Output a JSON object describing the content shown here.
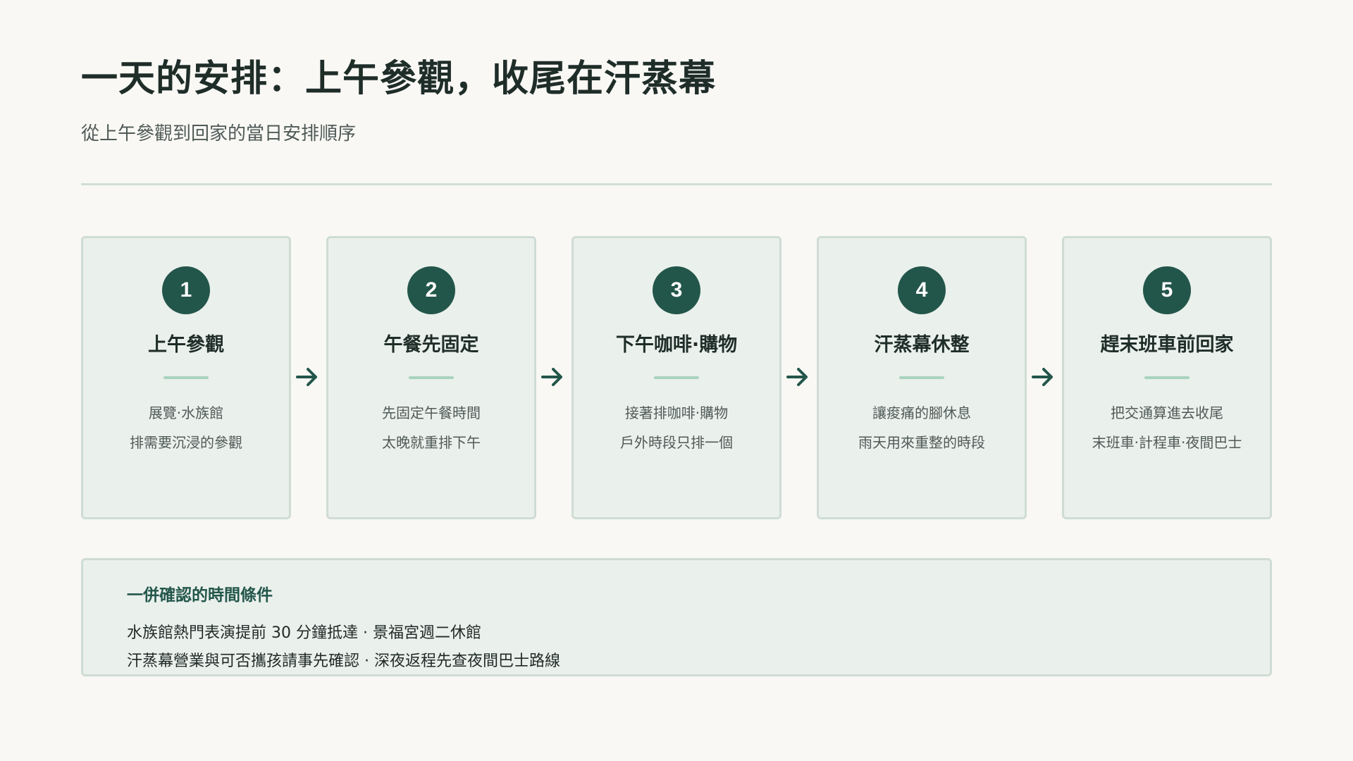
{
  "header": {
    "title": "一天的安排：上午參觀，收尾在汗蒸幕",
    "subtitle": "從上午參觀到回家的當日安排順序"
  },
  "colors": {
    "accent": "#23564a",
    "card_bg": "#eaf0ec",
    "card_border": "#cfdcd6",
    "bar": "#a8d3bf",
    "background": "#f9f8f5"
  },
  "steps": [
    {
      "number": "1",
      "title": "上午參觀",
      "line1": "展覽·水族館",
      "line2": "排需要沉浸的參觀"
    },
    {
      "number": "2",
      "title": "午餐先固定",
      "line1": "先固定午餐時間",
      "line2": "太晚就重排下午"
    },
    {
      "number": "3",
      "title": "下午咖啡·購物",
      "line1": "接著排咖啡·購物",
      "line2": "戶外時段只排一個"
    },
    {
      "number": "4",
      "title": "汗蒸幕休整",
      "line1": "讓痠痛的腳休息",
      "line2": "雨天用來重整的時段"
    },
    {
      "number": "5",
      "title": "趕末班車前回家",
      "line1": "把交通算進去收尾",
      "line2": "末班車·計程車·夜間巴士"
    }
  ],
  "arrows": {
    "icon": "arrow-right-icon"
  },
  "notes": {
    "heading": "一併確認的時間條件",
    "line1": "水族館熱門表演提前 30 分鐘抵達 · 景福宮週二休館",
    "line2": "汗蒸幕營業與可否攜孩請事先確認 · 深夜返程先查夜間巴士路線"
  }
}
